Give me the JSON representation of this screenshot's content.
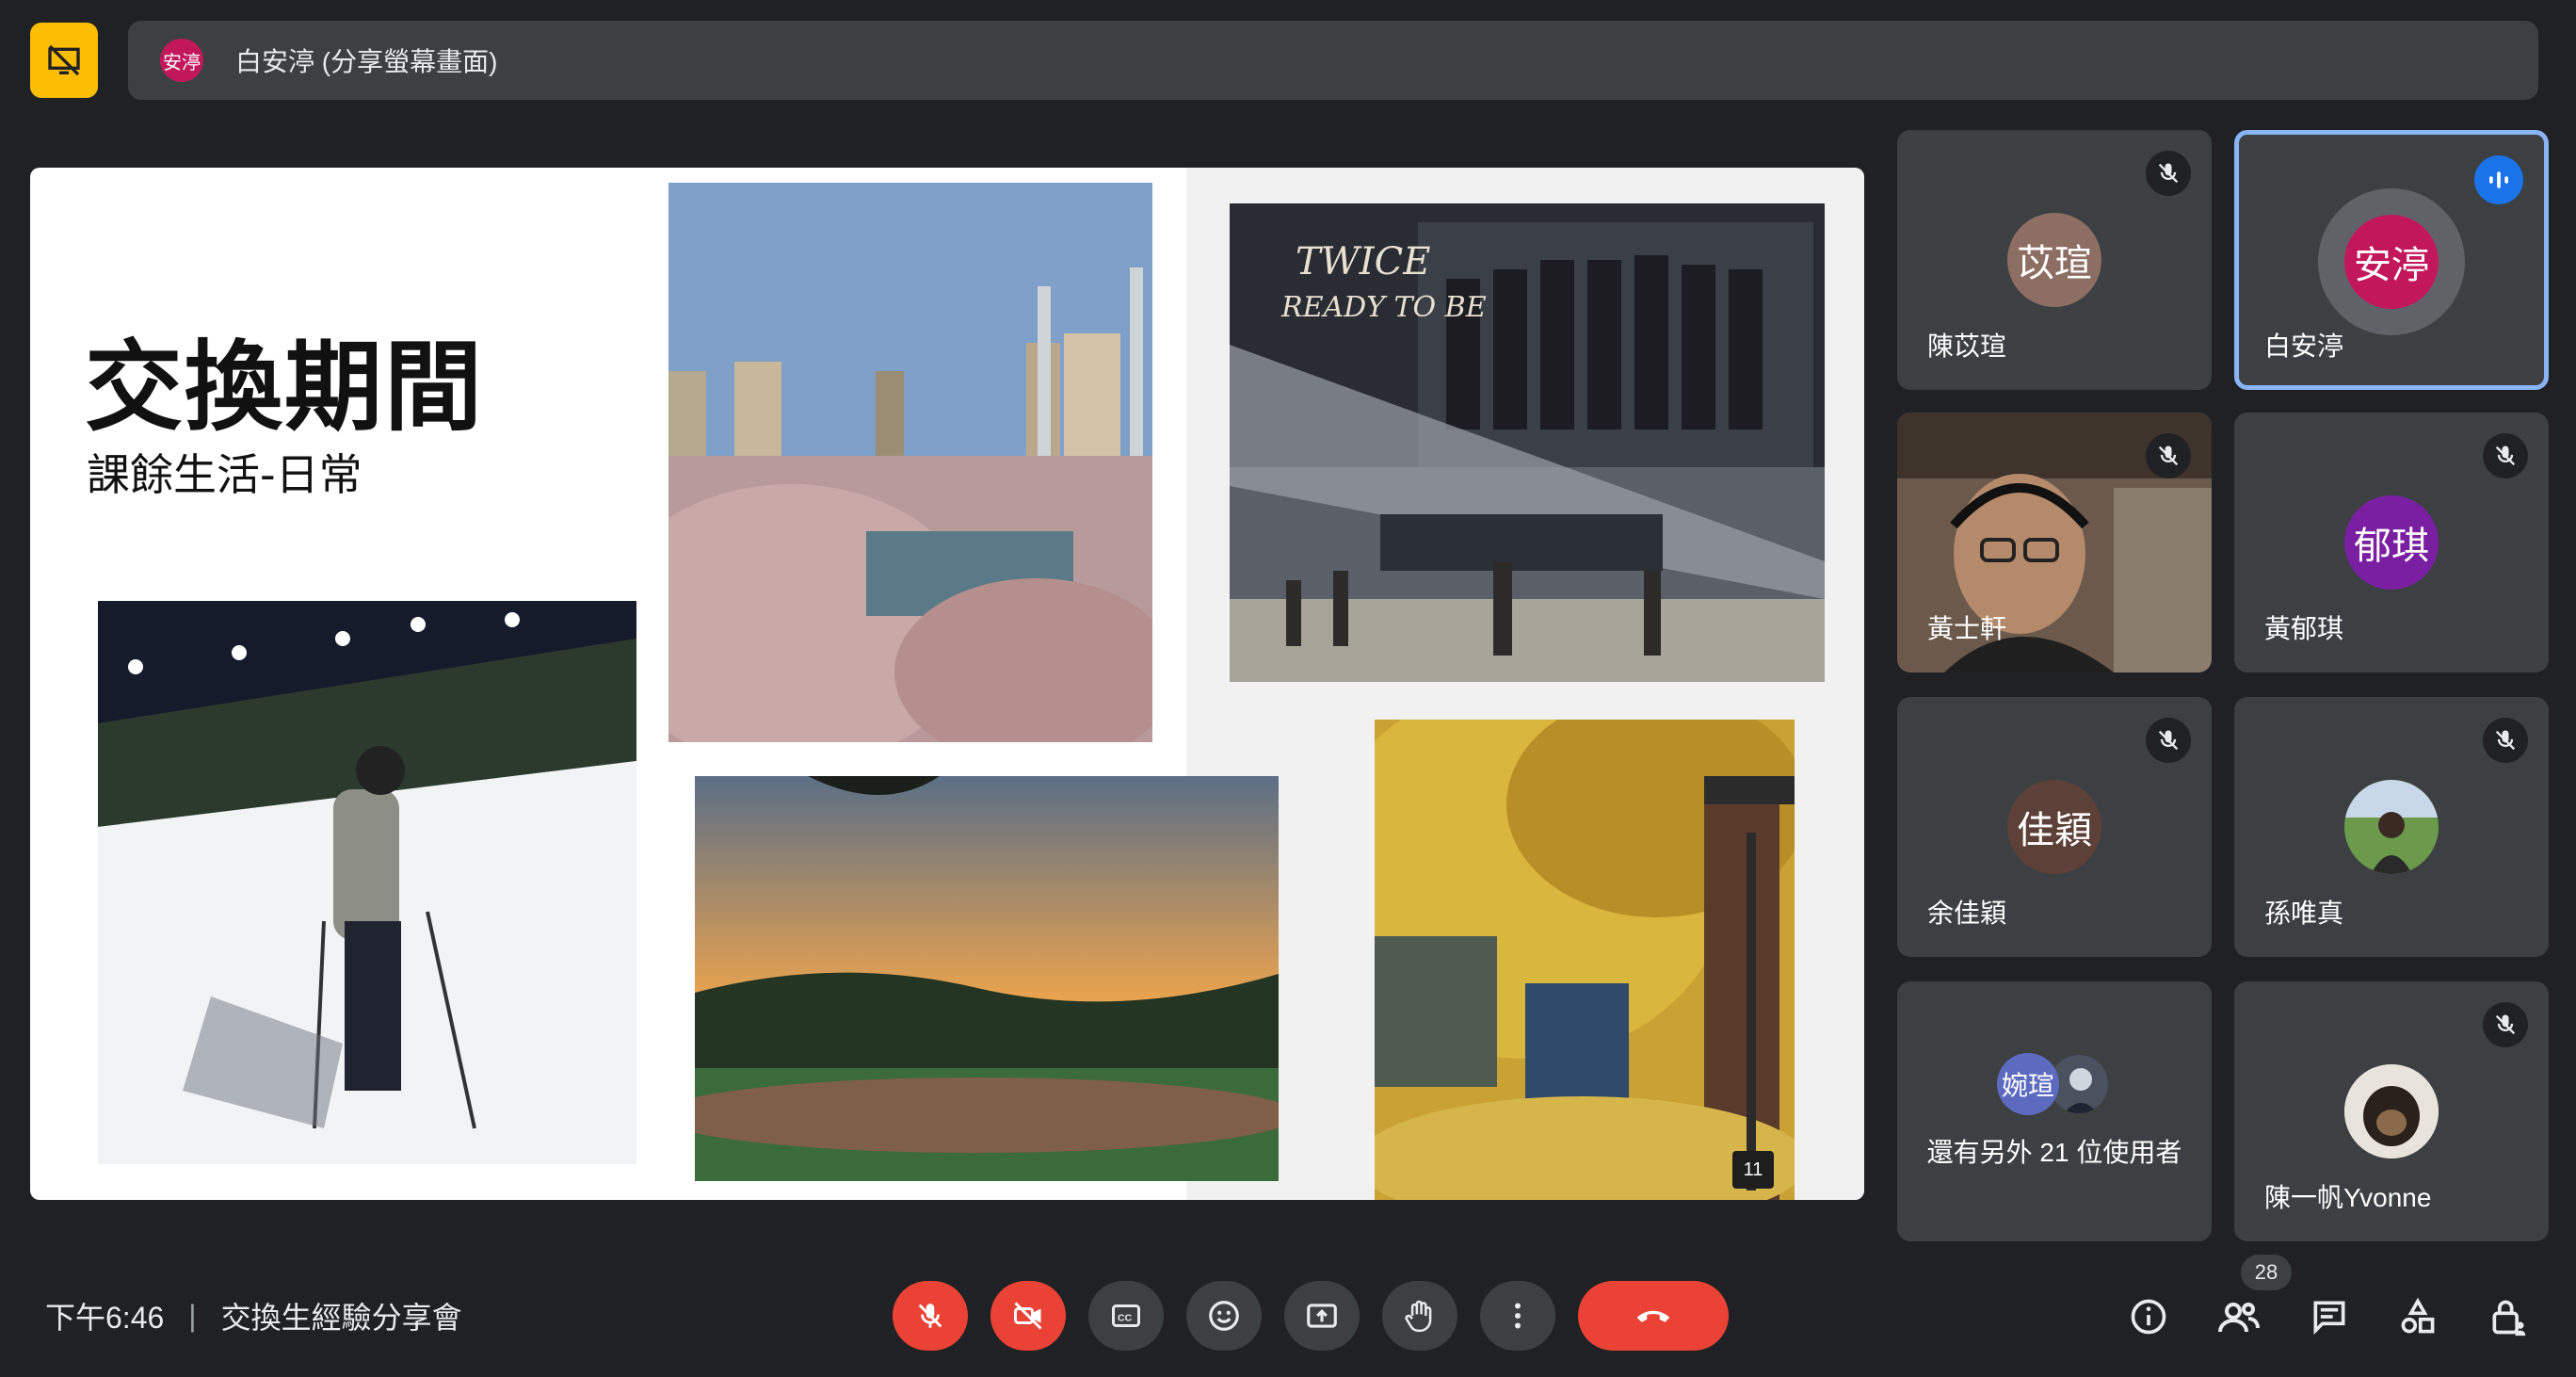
{
  "header": {
    "presenter_avatar": "安渟",
    "title": "白安渟 (分享螢幕畫面)"
  },
  "slide": {
    "title": "交換期間",
    "subtitle": "課餘生活-日常",
    "page_number": "11",
    "poster_text_1": "TWICE",
    "poster_text_2": "READY TO BE"
  },
  "participants": [
    {
      "avatar": "苡瑄",
      "name": "陳苡瑄",
      "color": "#8d6e63",
      "muted": true
    },
    {
      "avatar": "安渟",
      "name": "白安渟",
      "color": "#c2185b",
      "speaking": true
    },
    {
      "avatar": "",
      "name": "黃士軒",
      "muted": true
    },
    {
      "avatar": "郁琪",
      "name": "黃郁琪",
      "color": "#7b1fa2",
      "muted": true
    },
    {
      "avatar": "佳穎",
      "name": "余佳穎",
      "color": "#5d4037",
      "muted": true
    },
    {
      "avatar": "",
      "name": "孫唯真",
      "muted": true
    },
    {
      "avatar": "婉瑄",
      "name": "還有另外 21 位使用者"
    },
    {
      "avatar": "",
      "name": "陳一帆Yvonne",
      "muted": true
    }
  ],
  "bottom": {
    "time": "下午6:46",
    "meeting_name": "交換生經驗分享會",
    "people_count": "28"
  },
  "colors": {
    "accent": "#8ab4f8",
    "danger": "#ea4335",
    "control_bg": "#3c4043",
    "background": "#202124"
  }
}
